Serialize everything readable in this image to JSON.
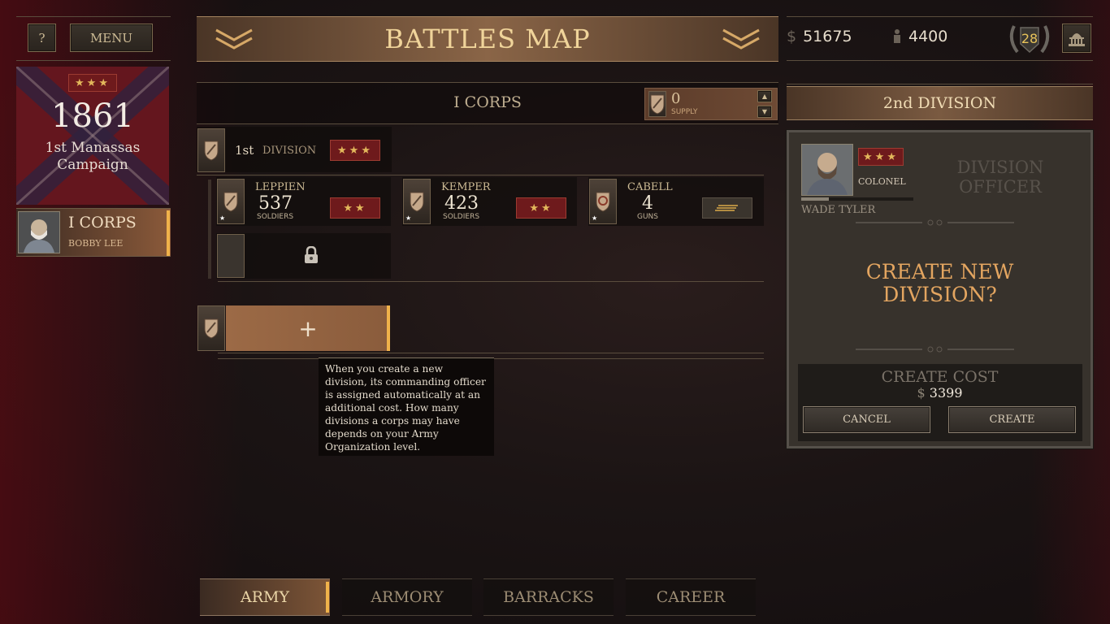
{
  "topbar": {
    "help_label": "?",
    "menu_label": "MENU",
    "title": "BATTLES MAP",
    "money_symbol": "$",
    "money": "51675",
    "soldiers": "4400",
    "level": "28"
  },
  "campaign": {
    "stars": "★★★",
    "year": "1861",
    "name_line1": "1st Manassas",
    "name_line2": "Campaign"
  },
  "corps_card": {
    "name": "I CORPS",
    "commander": "BOBBY LEE"
  },
  "corps_header": {
    "name": "I CORPS",
    "supply_value": "0",
    "supply_label": "SUPPLY"
  },
  "division": {
    "number": "1st",
    "label": "DIVISION",
    "stars": "★★★"
  },
  "brigades": [
    {
      "name": "LEPPIEN",
      "value": "537",
      "unit": "SOLDIERS",
      "stars": "★★"
    },
    {
      "name": "KEMPER",
      "value": "423",
      "unit": "SOLDIERS",
      "stars": "★★"
    },
    {
      "name": "CABELL",
      "value": "4",
      "unit": "GUNS",
      "stars": ""
    }
  ],
  "add_division_label": "+",
  "tooltip": "When you create a new division, its commanding officer is assigned automatically at an additional cost. How many divisions a corps may have depends on your Army Organization level.",
  "right_panel": {
    "header": "2nd DIVISION",
    "officer_stars": "★★★",
    "officer_rank": "COLONEL",
    "officer_name": "WADE TYLER",
    "officer_section_title_1": "DIVISION",
    "officer_section_title_2": "OFFICER",
    "prompt_line1": "CREATE NEW",
    "prompt_line2": "DIVISION?",
    "cost_label": "CREATE COST",
    "cost_symbol": "$",
    "cost_value": "3399",
    "cancel_label": "CANCEL",
    "create_label": "CREATE"
  },
  "tabs": [
    {
      "label": "ARMY",
      "active": true
    },
    {
      "label": "ARMORY",
      "active": false
    },
    {
      "label": "BARRACKS",
      "active": false
    },
    {
      "label": "CAREER",
      "active": false
    }
  ],
  "colors": {
    "accent_orange": "#f0b24a",
    "title_gold": "#f0d49a",
    "prompt_orange": "#e3a560",
    "star_gold": "#e2b75b"
  }
}
